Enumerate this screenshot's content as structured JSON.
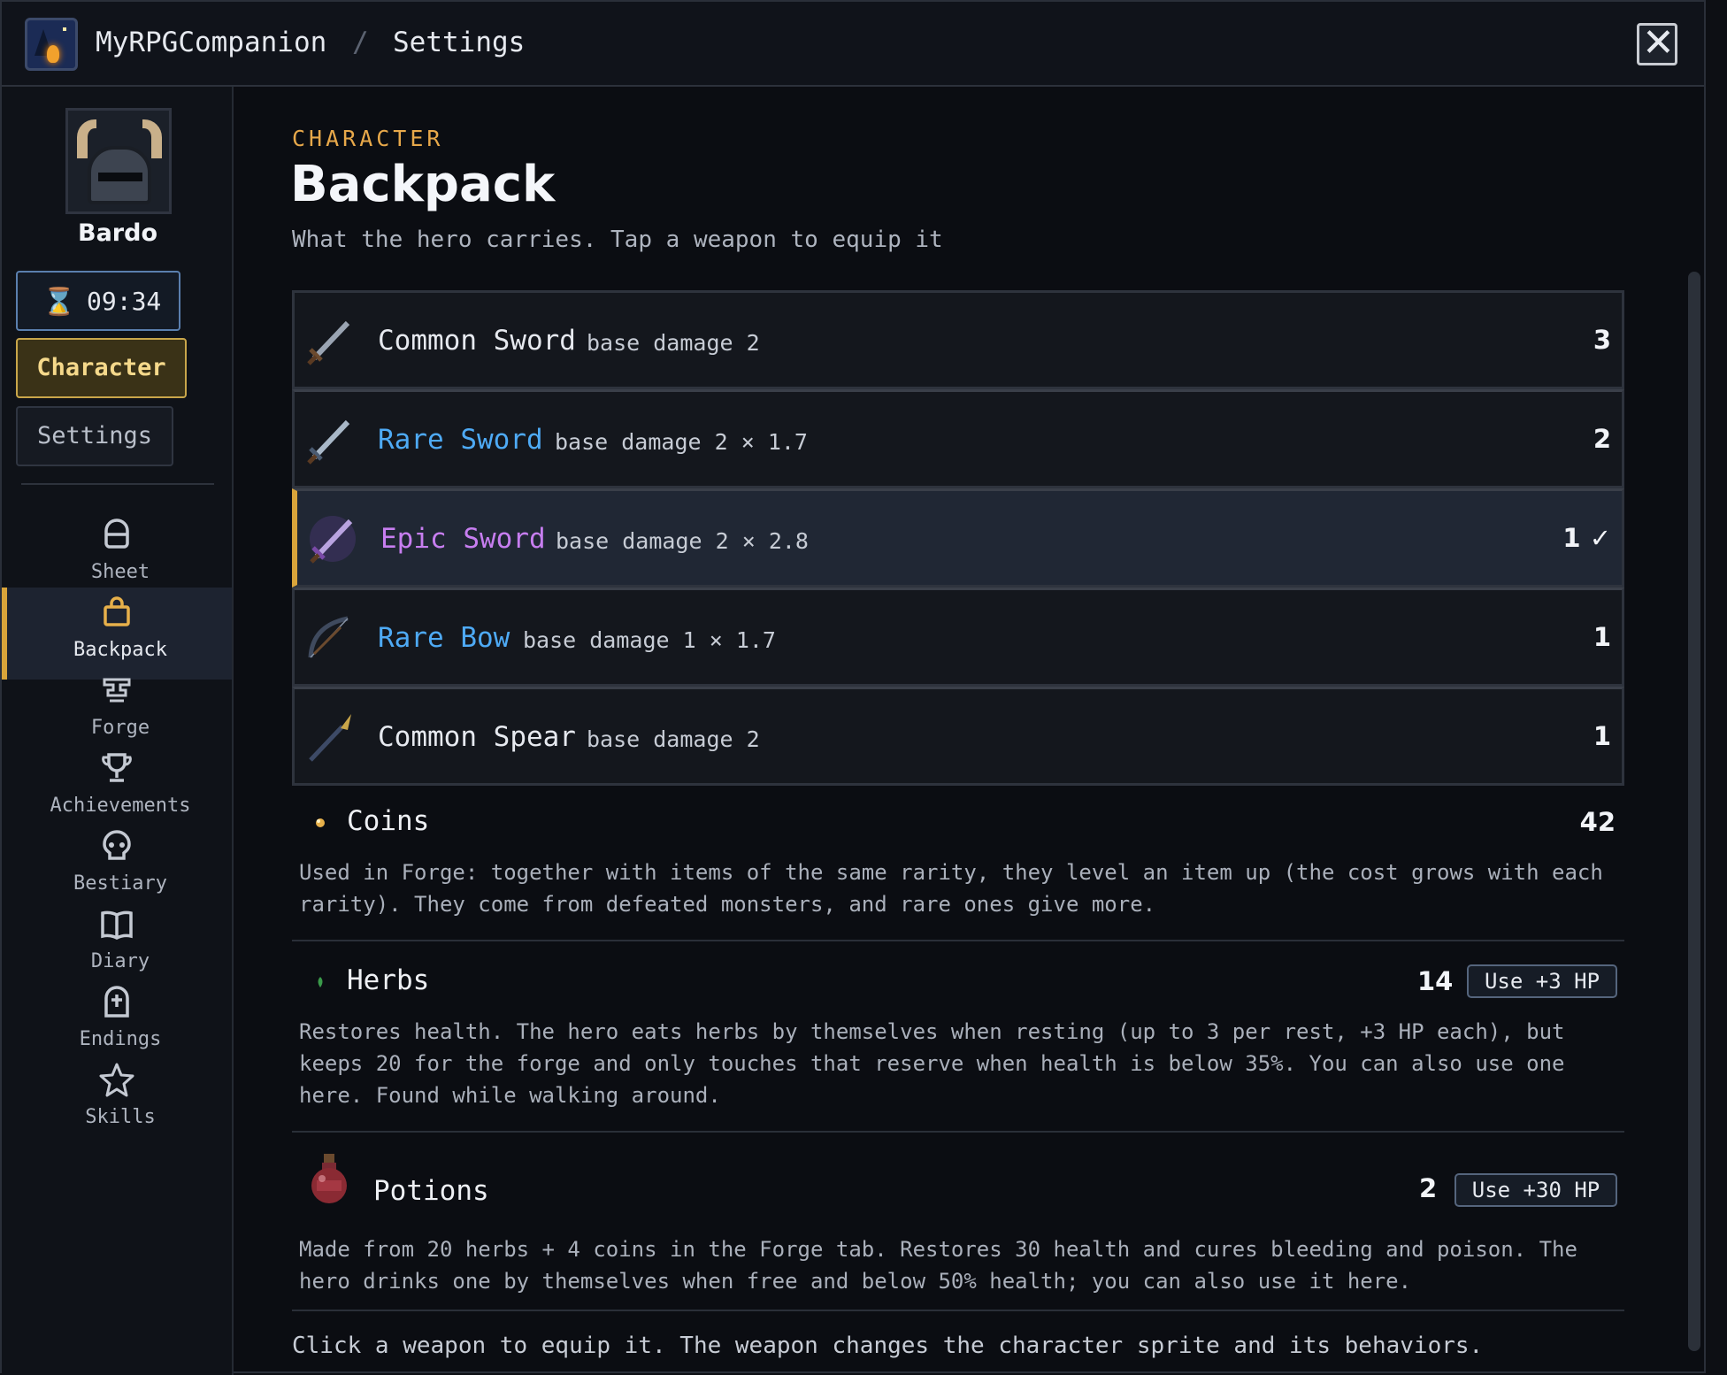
{
  "titlebar": {
    "app_name": "MyRPGCompanion",
    "separator": "/",
    "page": "Settings",
    "close_symbol": "✕"
  },
  "sidebar": {
    "character_name": "Bardo",
    "timer": "09:34",
    "character_button": "Character",
    "settings_button": "Settings",
    "items": [
      {
        "label": "Sheet",
        "icon": "helmet-icon"
      },
      {
        "label": "Backpack",
        "icon": "backpack-icon",
        "active": true
      },
      {
        "label": "Forge",
        "icon": "anvil-icon"
      },
      {
        "label": "Achievements",
        "icon": "trophy-icon"
      },
      {
        "label": "Bestiary",
        "icon": "skull-icon"
      },
      {
        "label": "Diary",
        "icon": "book-icon"
      },
      {
        "label": "Endings",
        "icon": "tombstone-icon"
      },
      {
        "label": "Skills",
        "icon": "star-icon"
      }
    ]
  },
  "main": {
    "kicker": "CHARACTER",
    "title": "Backpack",
    "subtitle": "What the hero carries. Tap a weapon to equip it"
  },
  "weapons": [
    {
      "rarity": "Common",
      "type": "Sword",
      "stat": "base damage 2",
      "qty": "3",
      "color": "#e6e9ef"
    },
    {
      "rarity": "Rare",
      "type": "Sword",
      "stat": "base damage 2 × 1.7",
      "qty": "2",
      "color": "#4eaaf5"
    },
    {
      "rarity": "Epic",
      "type": "Sword",
      "stat": "base damage 2 × 2.8",
      "qty": "1 ✓",
      "color": "#c77ef0",
      "equipped": true
    },
    {
      "rarity": "Rare",
      "type": "Bow",
      "stat": "base damage 1 × 1.7",
      "qty": "1",
      "color": "#4eaaf5"
    },
    {
      "rarity": "Common",
      "type": "Spear",
      "stat": "base damage 2",
      "qty": "1",
      "color": "#e6e9ef"
    }
  ],
  "resources": {
    "coins": {
      "name": "Coins",
      "qty": "42",
      "desc": "Used in Forge: together with items of the same rarity, they level an item up (the cost grows with each rarity). They come from defeated monsters, and rare ones give more."
    },
    "herbs": {
      "name": "Herbs",
      "qty": "14",
      "use_label": "Use +3 HP",
      "desc": "Restores health. The hero eats herbs by themselves when resting (up to 3 per rest, +3 HP each), but keeps 20 for the forge and only touches that reserve when health is below 35%. You can also use one here. Found while walking around."
    },
    "potions": {
      "name": "Potions",
      "qty": "2",
      "use_label": "Use +30 HP",
      "desc": "Made from 20 herbs + 4 coins in the Forge tab. Restores 30 health and cures bleeding and poison. The hero drinks one by themselves when free and below 50% health; you can also use it here."
    }
  },
  "footer": "Click a weapon to equip it. The weapon changes the character sprite and its behaviors.",
  "colors": {
    "accent": "#d9a43a",
    "rare": "#4eaaf5",
    "epic": "#c77ef0",
    "kicker": "#e7a84a"
  }
}
